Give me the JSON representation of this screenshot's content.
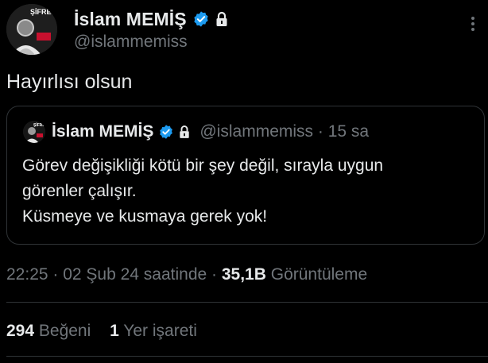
{
  "author": {
    "display_name": "İslam MEMİŞ",
    "handle": "@islammemiss",
    "avatar_logo_text": "ŞİFRE",
    "verified_icon": "verified-badge-icon",
    "protected_icon": "lock-icon"
  },
  "tweet": {
    "text": "Hayırlısı olsun"
  },
  "quoted": {
    "display_name": "İslam MEMİŞ",
    "handle_time": "@islammemiss · 15 sa",
    "lines": [
      "Görev değişikliği kötü bir şey değil, sırayla uygun",
      "görenler çalışır.",
      "Küsmeye ve kusmaya gerek yok!"
    ]
  },
  "meta": {
    "time_date": "22:25 · 02 Şub 24 saatinde · ",
    "views_count": "35,1B",
    "views_label": " Görüntüleme"
  },
  "stats": {
    "likes_count": "294",
    "likes_label": "Beğeni",
    "bookmarks_count": "1",
    "bookmarks_label": "Yer işareti"
  },
  "colors": {
    "background": "#000000",
    "text": "#e7e9ea",
    "muted": "#71767b",
    "border": "#2f3336",
    "verified": "#1d9bf0"
  }
}
